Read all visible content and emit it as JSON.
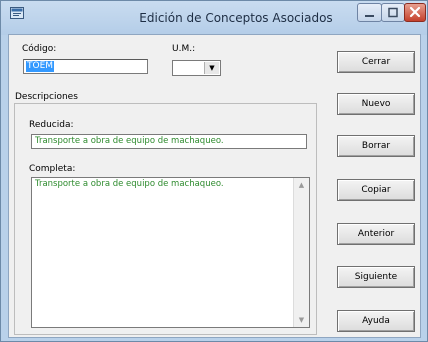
{
  "window": {
    "title": "Edición de Conceptos Asociados"
  },
  "fields": {
    "codigo_label": "Código:",
    "codigo_value": "TOEM",
    "um_label": "U.M.:",
    "um_value": ""
  },
  "descripciones": {
    "group_label": "Descripciones",
    "reducida_label": "Reducida:",
    "reducida_value": "Transporte a obra de equipo de machaqueo.",
    "completa_label": "Completa:",
    "completa_value": "Transporte a obra de equipo de machaqueo."
  },
  "buttons": {
    "cerrar": "Cerrar",
    "nuevo": "Nuevo",
    "borrar": "Borrar",
    "copiar": "Copiar",
    "anterior": "Anterior",
    "siguiente": "Siguiente",
    "ayuda": "Ayuda"
  },
  "icons": {
    "app": "app-window-icon",
    "minimize": "minimize-icon",
    "maximize": "maximize-icon",
    "close": "close-icon"
  }
}
